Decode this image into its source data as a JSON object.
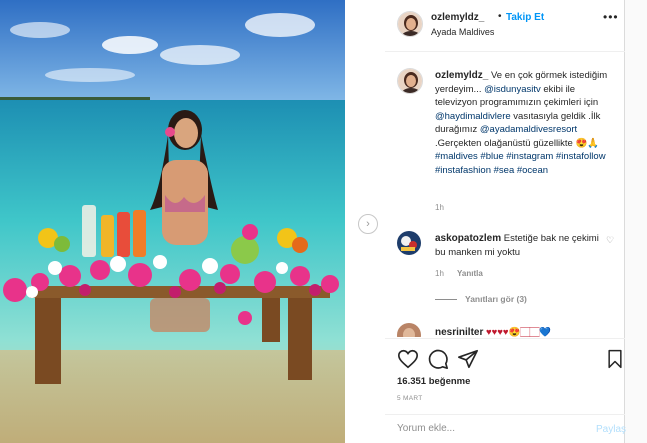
{
  "header": {
    "username": "ozlemyldz_",
    "dot": "•",
    "follow_label": "Takip Et",
    "location": "Ayada Maldives",
    "more_icon": "more-dots-icon"
  },
  "caption": {
    "username": "ozlemyldz_",
    "text_1": "Ve en çok görmek istediğim yerdeyim... ",
    "mention_1": "@isdunyasitv",
    "text_2": " ekibi ile televizyon programımızın çekimleri için ",
    "mention_2": "@haydimaldivlere",
    "text_3": " vasıtasıyla geldik .İlk durağımız ",
    "mention_3": "@ayadamaldivesresort",
    "text_4": " .Gerçekten olağanüstü güzellikte 😍🙏 ",
    "hashtags": "#maldives #blue #instagram #instafollow #instafashion #sea #ocean",
    "time": "1h"
  },
  "comments": [
    {
      "username": "askopatozlem",
      "text": "Estetiğe bak ne çekimi bu manken mi yoktu",
      "time": "1h",
      "reply_label": "Yanıtla",
      "view_replies": "Yanıtları gör (3)"
    },
    {
      "username": "nesrinilter",
      "text": "♥♥♥♥😍🏻🏻💙"
    }
  ],
  "actions": {
    "like_icon": "heart-icon",
    "comment_icon": "comment-icon",
    "share_icon": "share-icon",
    "save_icon": "bookmark-icon",
    "likes": "16.351 beğenme",
    "date": "5 MART"
  },
  "add_comment": {
    "placeholder": "Yorum ekle...",
    "post_label": "Paylaş"
  },
  "colors": {
    "link": "#00376b",
    "follow": "#0095f6",
    "muted": "#8e8e8e"
  }
}
